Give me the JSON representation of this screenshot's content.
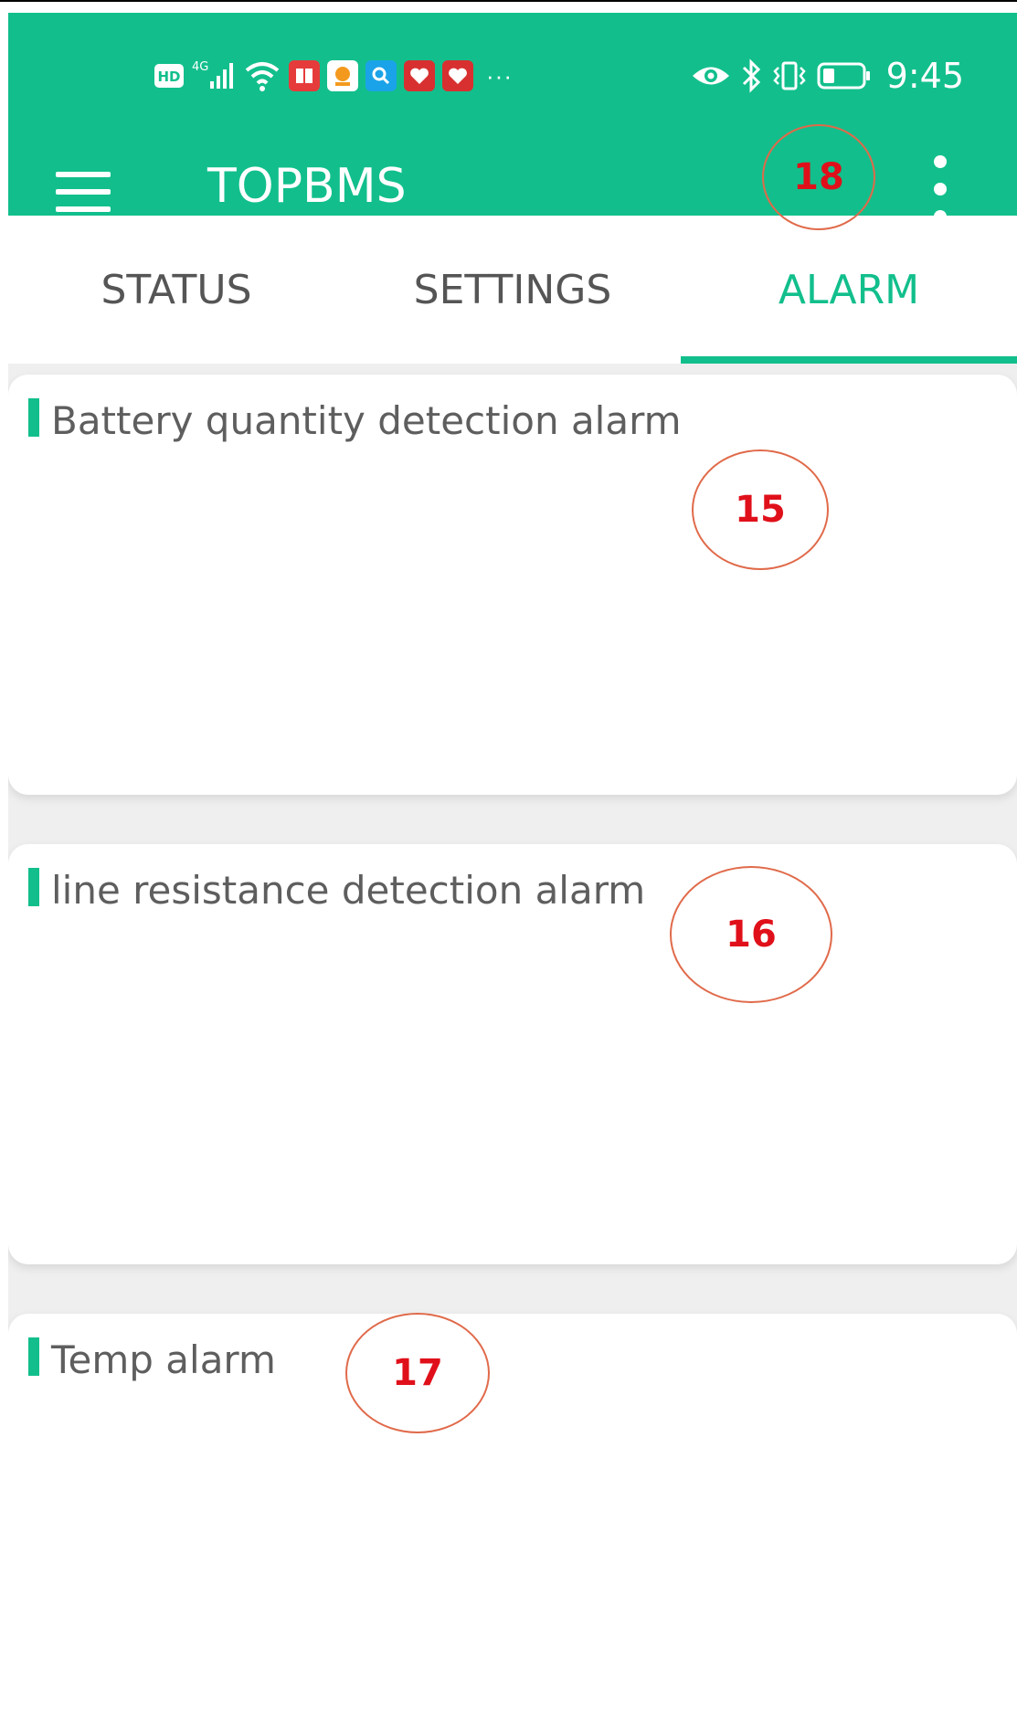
{
  "statusbar": {
    "hd_badge": "HD",
    "network_badge": "4G",
    "overflow_dots": "···",
    "time": "9:45",
    "left_icons": [
      "hd-icon",
      "signal-icon",
      "wifi-icon",
      "book-app-icon",
      "phone-app-icon",
      "search-app-icon",
      "heart-app-icon",
      "heart-app-icon"
    ],
    "right_icons": [
      "eye-icon",
      "bluetooth-icon",
      "vibrate-icon",
      "battery-icon"
    ]
  },
  "toolbar": {
    "title": "TOPBMS",
    "menu_icon": "hamburger-menu-icon",
    "overflow_icon": "more-vert-icon"
  },
  "tabs": [
    {
      "label": "STATUS",
      "active": false
    },
    {
      "label": "SETTINGS",
      "active": false
    },
    {
      "label": "ALARM",
      "active": true
    }
  ],
  "cards": [
    {
      "title": "Battery quantity detection alarm"
    },
    {
      "title": "line resistance detection alarm"
    },
    {
      "title": "Temp alarm"
    }
  ],
  "annotations": {
    "marker_15": "15",
    "marker_16": "16",
    "marker_17": "17",
    "marker_18": "18"
  },
  "colors": {
    "accent": "#12bf8c",
    "annotation_text": "#e0101a",
    "annotation_outline": "#e06a4a"
  }
}
